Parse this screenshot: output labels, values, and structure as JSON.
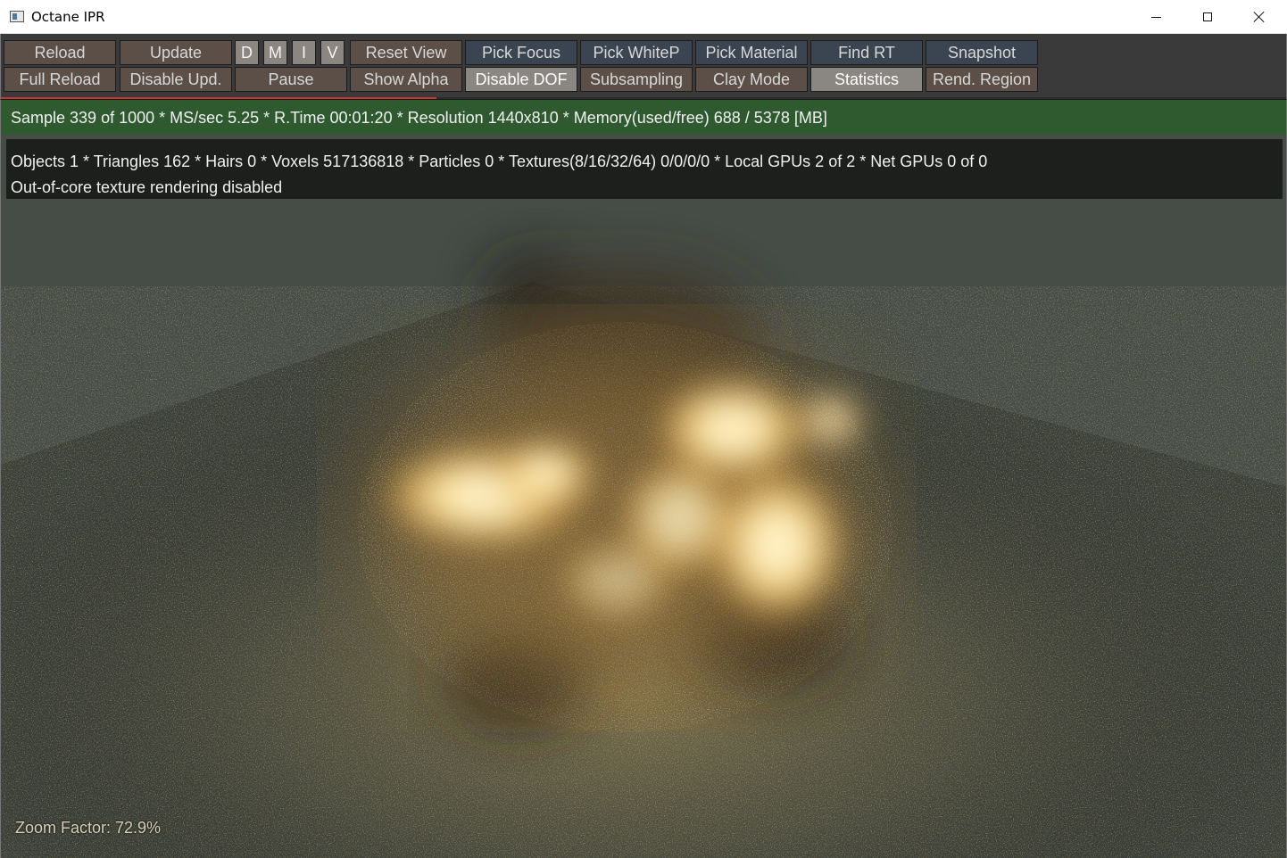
{
  "window": {
    "title": "Octane IPR"
  },
  "toolbar": {
    "row1": {
      "reload": "Reload",
      "update": "Update",
      "d": "D",
      "m": "M",
      "i": "I",
      "v": "V",
      "reset_view": "Reset View",
      "pick_focus": "Pick Focus",
      "pick_whitep": "Pick WhiteP",
      "pick_material": "Pick Material",
      "find_rt": "Find RT",
      "snapshot": "Snapshot"
    },
    "row2": {
      "full_reload": "Full Reload",
      "disable_upd": "Disable Upd.",
      "pause": "Pause",
      "show_alpha": "Show Alpha",
      "disable_dof": "Disable DOF",
      "subsampling": "Subsampling",
      "clay_mode": "Clay Mode",
      "statistics": "Statistics",
      "rend_region": "Rend. Region"
    },
    "render_progress": 0.339
  },
  "status": {
    "sample_line": "Sample 339 of 1000 * MS/sec 5.25 * R.Time 00:01:20 * Resolution 1440x810 * Memory(used/free) 688 / 5378 [MB]"
  },
  "stats": {
    "line1": "Objects 1 * Triangles 162 * Hairs 0 * Voxels 517136818 * Particles 0 * Textures(8/16/32/64) 0/0/0/0 * Local GPUs 2 of 2 * Net GPUs 0 of 0",
    "line2": "Out-of-core texture rendering disabled"
  },
  "viewport": {
    "zoom_label": "Zoom Factor: 72.9%"
  },
  "colors": {
    "status_bar": "#2f5a30",
    "progress": "#c8352e",
    "button_brown": "#5b4f48",
    "button_blue": "#3b4451",
    "button_active": "#8a8682"
  }
}
